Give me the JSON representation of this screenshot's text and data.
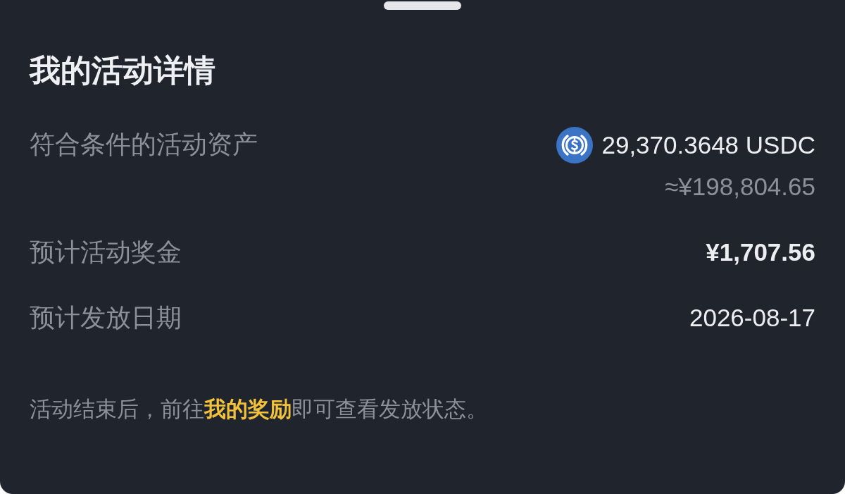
{
  "sheet": {
    "title": "我的活动详情"
  },
  "rows": [
    {
      "kind": "asset",
      "label": "符合条件的活动资产",
      "value": "29,370.3648 USDC",
      "subvalue": "≈¥198,804.65"
    },
    {
      "kind": "amount",
      "label": "预计活动奖金",
      "value": "¥1,707.56"
    },
    {
      "kind": "date",
      "label": "预计发放日期",
      "value": "2026-08-17"
    }
  ],
  "note": {
    "before": "活动结束后，前往",
    "link": "我的奖励",
    "after": "即可查看发放状态。"
  }
}
